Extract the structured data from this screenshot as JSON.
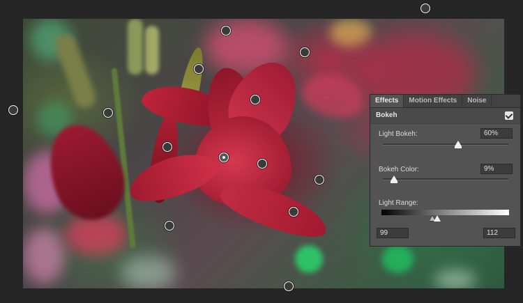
{
  "tabs": [
    {
      "label": "Effects",
      "active": true
    },
    {
      "label": "Motion Effects",
      "active": false
    },
    {
      "label": "Noise",
      "active": false
    }
  ],
  "section": {
    "title": "Bokeh",
    "checked": true
  },
  "light_bokeh": {
    "label": "Light Bokeh:",
    "value": "60%",
    "level": 0.6
  },
  "bokeh_color": {
    "label": "Bokeh Color:",
    "value": "9%",
    "level": 0.09
  },
  "light_range": {
    "label": "Light Range:",
    "low": "99",
    "high": "112"
  },
  "colors": {
    "background": "#262626",
    "panel": "#535353",
    "tab_bar": "#424242"
  }
}
